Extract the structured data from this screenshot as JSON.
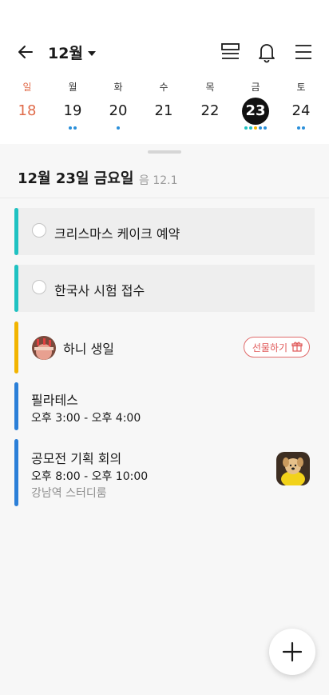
{
  "header": {
    "month": "12월",
    "icons": [
      "back-arrow-icon",
      "list-view-icon",
      "bell-icon",
      "menu-icon"
    ]
  },
  "week": [
    {
      "wd": "일",
      "num": "18",
      "dots": 0
    },
    {
      "wd": "월",
      "num": "19",
      "dots": 2
    },
    {
      "wd": "화",
      "num": "20",
      "dots": 1
    },
    {
      "wd": "수",
      "num": "21",
      "dots": 0
    },
    {
      "wd": "목",
      "num": "22",
      "dots": 0
    },
    {
      "wd": "금",
      "num": "23",
      "dots": 5
    },
    {
      "wd": "토",
      "num": "24",
      "dots": 2
    }
  ],
  "selected": {
    "title": "12월 23일 금요일",
    "lunar": "음 12.1"
  },
  "events": {
    "task1": {
      "label": "크리스마스 케이크 예약",
      "color": "#1fc2c2"
    },
    "task2": {
      "label": "한국사 시험 접수",
      "color": "#1fc2c2"
    },
    "birthday": {
      "label": "하니 생일",
      "gift": "선물하기",
      "color": "#f2b400"
    },
    "pilates": {
      "title": "필라테스",
      "time": "오후 3:00 - 오후 4:00",
      "color": "#2b7fd8"
    },
    "meeting": {
      "title": "공모전 기획 회의",
      "time": "오후 8:00 - 오후 10:00",
      "location": "강남역 스터디룸",
      "color": "#2b7fd8"
    }
  },
  "colors": {
    "sunday": "#e06b4a",
    "dot": "#2a8fd9",
    "selected_bg": "#111111"
  }
}
